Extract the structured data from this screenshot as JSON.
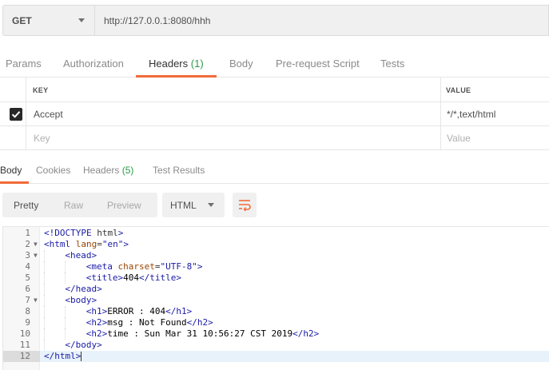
{
  "request": {
    "method": "GET",
    "url": "http://127.0.0.1:8080/hhh"
  },
  "request_tabs": [
    {
      "label": "Params"
    },
    {
      "label": "Authorization"
    },
    {
      "label": "Headers",
      "count": "(1)",
      "active": true
    },
    {
      "label": "Body"
    },
    {
      "label": "Pre-request Script"
    },
    {
      "label": "Tests"
    }
  ],
  "headers_table": {
    "columns": {
      "key": "KEY",
      "value": "VALUE"
    },
    "rows": [
      {
        "checked": true,
        "key": "Accept",
        "value": "*/*,text/html"
      }
    ],
    "placeholder": {
      "key": "Key",
      "value": "Value"
    }
  },
  "response_tabs": [
    {
      "label": "Body",
      "active": true
    },
    {
      "label": "Cookies"
    },
    {
      "label": "Headers",
      "count": "(5)"
    },
    {
      "label": "Test Results"
    }
  ],
  "view_modes": [
    {
      "label": "Pretty",
      "active": true
    },
    {
      "label": "Raw"
    },
    {
      "label": "Preview"
    }
  ],
  "format": {
    "selected": "HTML"
  },
  "code_lines": [
    {
      "n": "1",
      "text": "<!DOCTYPE html>"
    },
    {
      "n": "2",
      "text": "<html lang=\"en\">",
      "fold": true
    },
    {
      "n": "3",
      "text": "<head>",
      "fold": true
    },
    {
      "n": "4",
      "text": "<meta charset=\"UTF-8\">"
    },
    {
      "n": "5",
      "text": "<title>404</title>"
    },
    {
      "n": "6",
      "text": "</head>"
    },
    {
      "n": "7",
      "text": "<body>",
      "fold": true
    },
    {
      "n": "8",
      "text": "<h1>ERROR : 404</h1>"
    },
    {
      "n": "9",
      "text": "<h2>msg : Not Found</h2>"
    },
    {
      "n": "10",
      "text": "<h2>time : Sun Mar 31 10:56:27 CST 2019</h2>"
    },
    {
      "n": "11",
      "text": "</body>"
    },
    {
      "n": "12",
      "text": "</html>",
      "highlight": true
    }
  ],
  "colors": {
    "accent": "#f26b3a",
    "count_green": "#2a9a4a",
    "tag_blue": "#1a1aa6",
    "attr_brown": "#994500"
  }
}
